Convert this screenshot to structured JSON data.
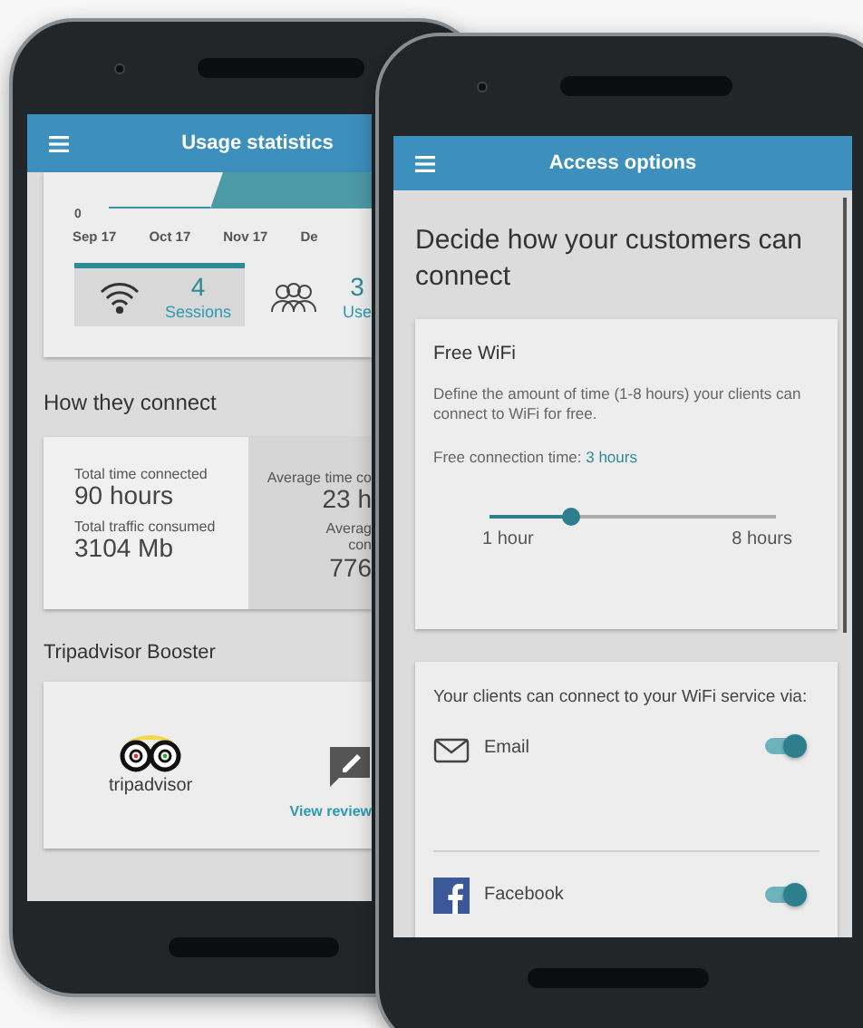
{
  "usage_screen": {
    "title": "Usage statistics",
    "chart": {
      "y_tick": "0",
      "x_labels": [
        "Sep 17",
        "Oct 17",
        "Nov 17",
        "De"
      ]
    },
    "stat_tiles": [
      {
        "kind": "sessions",
        "value": "4",
        "label": "Sessions",
        "selected": true
      },
      {
        "kind": "users",
        "value": "3",
        "label": "Use",
        "selected": false
      }
    ],
    "connect_heading": "How they connect",
    "totals": [
      {
        "label": "Total time connected",
        "value": "90 hours"
      },
      {
        "label": "Total traffic consumed",
        "value": "3104 Mb"
      }
    ],
    "averages": [
      {
        "label": "Average time co",
        "value": "23 h"
      },
      {
        "label": "Averag",
        "label_2": "con",
        "value": "776"
      }
    ],
    "booster_heading": "Tripadvisor Booster",
    "booster": {
      "logo_text": "tripadvisor",
      "link": "View review"
    }
  },
  "access_screen": {
    "title": "Access options",
    "heading": "Decide how your customers can connect",
    "free_wifi": {
      "title": "Free WiFi",
      "description": "Define the amount of time (1-8 hours) your clients can connect to WiFi for free.",
      "time_label": "Free connection time:",
      "time_value": "3 hours",
      "level": 0.286,
      "min_label": "1 hour",
      "max_label": "8 hours"
    },
    "methods_intro": "Your clients can connect to your WiFi service via:",
    "methods": [
      {
        "kind": "email",
        "label": "Email",
        "on": true
      },
      {
        "kind": "facebook",
        "label": "Facebook",
        "on": true
      }
    ]
  }
}
